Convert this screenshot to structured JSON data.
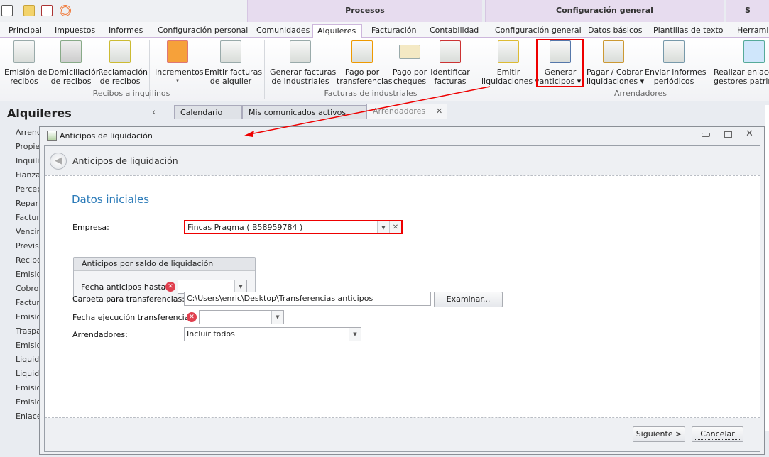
{
  "quick_access": {
    "icons": [
      "app-menu-icon",
      "mail-icon",
      "clipboard-check-icon",
      "broadcast-icon"
    ]
  },
  "context_groups": [
    {
      "label": "Procesos"
    },
    {
      "label": "Configuración general"
    },
    {
      "label": "S"
    }
  ],
  "tabs": [
    {
      "label": "Principal"
    },
    {
      "label": "Impuestos"
    },
    {
      "label": "Informes"
    },
    {
      "label": "Configuración personal"
    },
    {
      "label": "Comunidades"
    },
    {
      "label": "Alquileres",
      "active": true
    },
    {
      "label": "Facturación"
    },
    {
      "label": "Contabilidad"
    },
    {
      "label": "Configuración general"
    },
    {
      "label": "Datos básicos"
    },
    {
      "label": "Plantillas de texto"
    },
    {
      "label": "Herramien"
    }
  ],
  "ribbon": {
    "buttons": [
      {
        "l1": "Emisión de",
        "l2": "recibos"
      },
      {
        "l1": "Domiciliación",
        "l2": "de recibos"
      },
      {
        "l1": "Reclamación",
        "l2": "de recibos"
      },
      {
        "l1": "Incrementos",
        "l2": "▾"
      },
      {
        "l1": "Emitir facturas",
        "l2": "de alquiler"
      },
      {
        "l1": "Generar facturas",
        "l2": "de industriales"
      },
      {
        "l1": "Pago por",
        "l2": "transferencias"
      },
      {
        "l1": "Pago por",
        "l2": "cheques"
      },
      {
        "l1": "Identificar",
        "l2": "facturas"
      },
      {
        "l1": "Emitir",
        "l2": "liquidaciones ▾"
      },
      {
        "l1": "Generar",
        "l2": "anticipos ▾"
      },
      {
        "l1": "Pagar / Cobrar",
        "l2": "liquidaciones ▾"
      },
      {
        "l1": "Enviar informes",
        "l2": "periódicos"
      },
      {
        "l1": "Realizar enlace c",
        "l2": "gestores patrim"
      }
    ],
    "groups": [
      "Recibos a inquilinos",
      "Facturas de industriales",
      "Arrendadores"
    ]
  },
  "sidebar": {
    "title": "Alquileres",
    "collapse": "‹",
    "items": [
      "Arrend",
      "Propie",
      "Inquilin",
      "Fianza",
      "Percep",
      "Repart",
      "Factur",
      "Vencim",
      "Previsi",
      "Recibo",
      "Emision",
      "Cobros",
      "Factur",
      "Emision",
      "Traspa",
      "Emision",
      "Liquida",
      "Liquida",
      "Emision",
      "Emision",
      "Enlace"
    ]
  },
  "doc_tabs": [
    {
      "label": "Calendario"
    },
    {
      "label": "Mis comunicados activos"
    },
    {
      "label": "Arrendadores",
      "close": "✕"
    }
  ],
  "dialog": {
    "title": "Anticipos de liquidación",
    "header": "Anticipos de liquidación",
    "section": "Datos iniciales",
    "empresa": {
      "label": "Empresa:",
      "value": "Fincas Pragma ( B58959784 )"
    },
    "group": {
      "title": "Anticipos por saldo de liquidación",
      "fecha_label": "Fecha anticipos hasta:",
      "fecha_value": ""
    },
    "carpeta": {
      "label": "Carpeta para transferencias:",
      "value": "C:\\Users\\enric\\Desktop\\Transferencias anticipos",
      "browse": "Examinar..."
    },
    "fecha_ejec": {
      "label": "Fecha ejecución transferencias:",
      "value": ""
    },
    "arrendadores": {
      "label": "Arrendadores:",
      "value": "Incluir todos"
    },
    "next": "Siguiente >",
    "cancel": "Cancelar"
  },
  "colors": {
    "accent": "#2a7ab8",
    "highlight": "#e00000",
    "error": "#e0404f",
    "context": "#e7dcef"
  }
}
